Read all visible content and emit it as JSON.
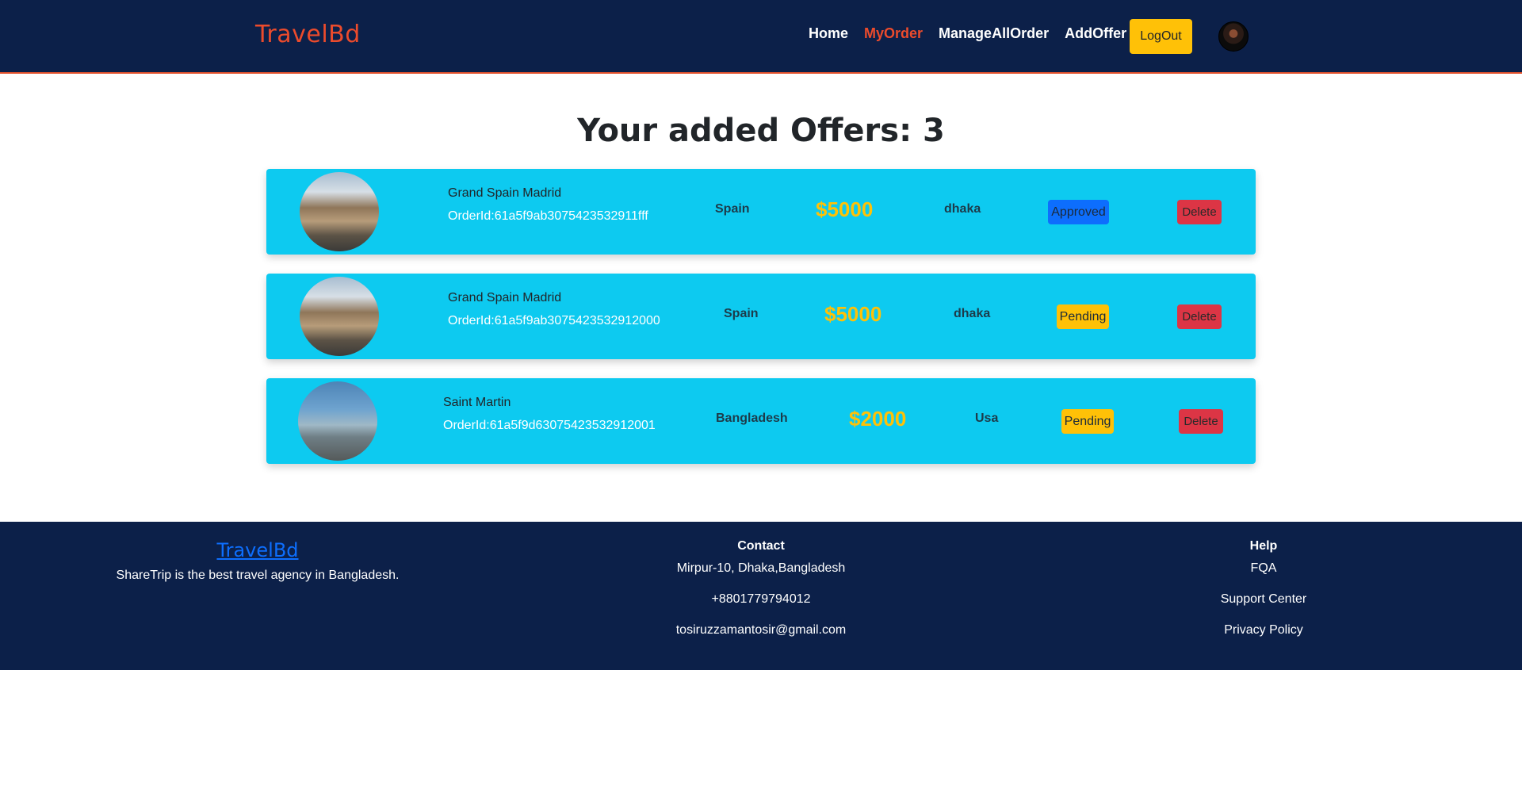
{
  "navbar": {
    "brand": "TravelBd",
    "links": [
      "Home",
      "MyOrder",
      "ManageAllOrder",
      "AddOffer"
    ],
    "active_link": "MyOrder",
    "logout_label": "LogOut"
  },
  "main": {
    "title": "Your added Offers: 3",
    "orders": [
      {
        "name": "Grand Spain Madrid",
        "order_id": "OrderId:61a5f9ab3075423532911fff",
        "country": "Spain",
        "price": "$5000",
        "city": "dhaka",
        "status": "Approved",
        "delete_label": "Delete"
      },
      {
        "name": "Grand Spain Madrid",
        "order_id": "OrderId:61a5f9ab3075423532912000",
        "country": "Spain",
        "price": "$5000",
        "city": "dhaka",
        "status": "Pending",
        "delete_label": "Delete"
      },
      {
        "name": "Saint Martin",
        "order_id": "OrderId:61a5f9d63075423532912001",
        "country": "Bangladesh",
        "price": "$2000",
        "city": "Usa",
        "status": "Pending",
        "delete_label": "Delete"
      }
    ]
  },
  "footer": {
    "brand": "TravelBd",
    "tagline": "ShareTrip is the best travel agency in Bangladesh.",
    "contact": {
      "heading": "Contact",
      "address": "Mirpur-10, Dhaka,Bangladesh",
      "phone": "+8801779794012",
      "email": "tosiruzzamantosir@gmail.com"
    },
    "help": {
      "heading": "Help",
      "links": [
        "FQA",
        "Support Center",
        "Privacy Policy"
      ]
    }
  },
  "colors": {
    "navy": "#0c2049",
    "accent": "#ec4b2c",
    "card": "#0dcaf0",
    "price": "#ffc107",
    "approved": "#0d6efd",
    "pending": "#ffc107",
    "delete": "#dc3545"
  },
  "icons": [
    "avatar",
    "madrid-photo",
    "beach-photo"
  ]
}
